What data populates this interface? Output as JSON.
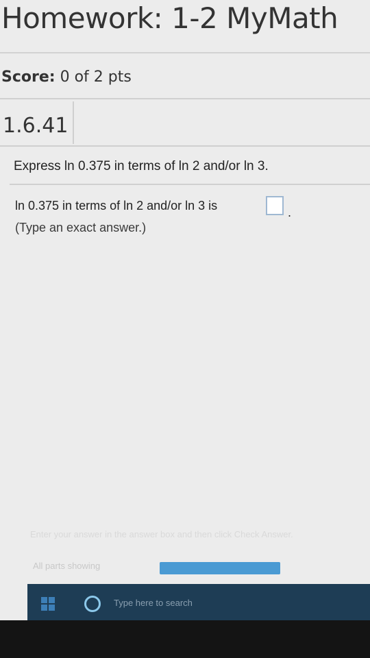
{
  "header": {
    "title": "Homework: 1-2 MyMath",
    "score_label": "Score:",
    "score_value": "0 of 2 pts"
  },
  "question": {
    "number": "1.6.41",
    "prompt": "Express ln 0.375 in terms of ln 2 and/or ln 3.",
    "answer_prefix": "ln 0.375 in terms of ln 2 and/or ln 3 is",
    "answer_value": "",
    "answer_suffix": ".",
    "hint": "(Type an exact answer.)"
  },
  "footer": {
    "instruction": "Enter your answer in the answer box and then click Check Answer.",
    "parts_label": "All parts showing",
    "progress": 1.0
  },
  "taskbar": {
    "search_placeholder": "Type here to search",
    "start_icon": "windows-logo-icon",
    "search_icon": "cortana-circle-icon"
  },
  "colors": {
    "page_bg": "#ececec",
    "progress_fill": "#4a9ad3",
    "taskbar_bg": "#1e3d55",
    "answer_box_border": "#9fb8d2"
  }
}
